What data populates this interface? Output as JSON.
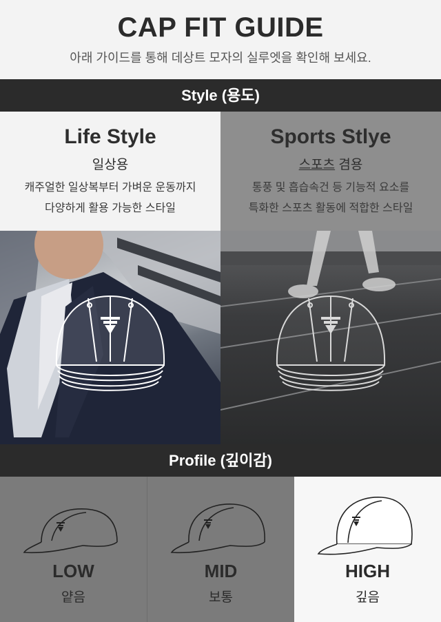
{
  "header": {
    "title": "CAP FIT GUIDE",
    "subtitle": "아래 가이드를 통해 데상트 모자의 실루엣을 확인해 보세요."
  },
  "style_section": {
    "bar_label": "Style (용도)",
    "left": {
      "name": "Life Style",
      "korean": "일상용",
      "desc_line1": "캐주얼한 일상복부터 가벼운 운동까지",
      "desc_line2": "다양하게 활용 가능한 스타일"
    },
    "right": {
      "name": "Sports Stlye",
      "korean_underlined": "스포츠",
      "korean_rest": " 겸용",
      "desc_line1": "통풍 및 흡습속건 등 기능적 요소를",
      "desc_line2": "특화한 스포츠 활동에 적합한 스타일"
    }
  },
  "profile_section": {
    "bar_label": "Profile (깊이감)",
    "items": [
      {
        "label": "LOW",
        "korean": "얕음"
      },
      {
        "label": "MID",
        "korean": "보통"
      },
      {
        "label": "HIGH",
        "korean": "깊음"
      }
    ]
  },
  "colors": {
    "dark_bar": "#2b2b2b",
    "light_bg": "#f3f3f3",
    "gray_panel": "#8e8e8e",
    "profile_gray": "#7b7b7b"
  }
}
